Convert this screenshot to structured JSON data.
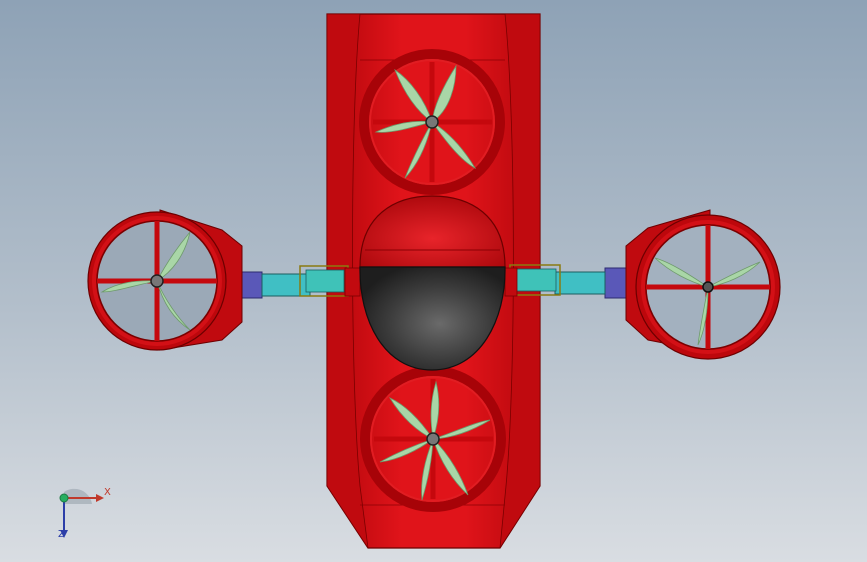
{
  "viewport": {
    "background_top": "#8ea2b6",
    "background_bottom": "#d9dde2"
  },
  "model": {
    "body_color": "#d60d12",
    "body_edge_color": "#7a0000",
    "dome_color": "#3a3a3a",
    "blade_color": "#a9d6a7",
    "arm_color": "#40bfc4",
    "mount_color": "#5a58b8"
  },
  "triad": {
    "x_label": "X",
    "z_label": "Z",
    "x_color": "#c0392b",
    "y_color": "#27ae60",
    "z_color": "#2c3ea8"
  }
}
